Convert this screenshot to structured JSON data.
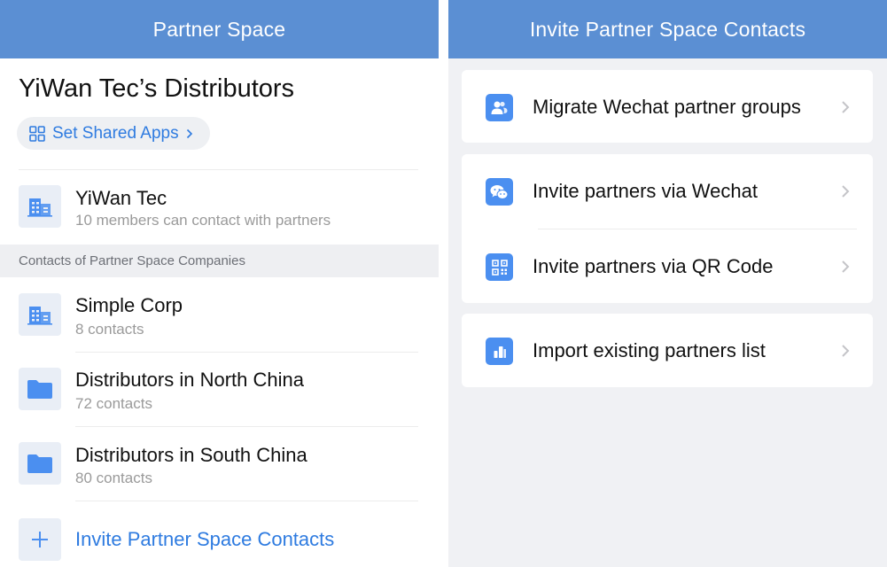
{
  "left_panel": {
    "nav_title": "Partner Space",
    "org_title": "YiWan Tec’s Distributors",
    "shared_apps_label": "Set Shared Apps",
    "own_company": {
      "name": "YiWan Tec",
      "subtitle": "10 members can contact with partners"
    },
    "section_header": "Contacts of Partner Space Companies",
    "companies": [
      {
        "name": "Simple Corp",
        "subtitle": "8 contacts",
        "icon": "building-icon"
      },
      {
        "name": "Distributors in North China",
        "subtitle": "72 contacts",
        "icon": "folder-icon"
      },
      {
        "name": "Distributors in South China",
        "subtitle": "80 contacts",
        "icon": "folder-icon"
      }
    ],
    "invite_label": "Invite Partner Space Contacts"
  },
  "right_panel": {
    "nav_title": "Invite Partner Space Contacts",
    "options": [
      {
        "label": "Migrate Wechat partner groups",
        "icon": "people-icon"
      },
      {
        "label": "Invite partners via Wechat",
        "icon": "wechat-icon"
      },
      {
        "label": "Invite partners via QR Code",
        "icon": "qr-code-icon"
      },
      {
        "label": "Import existing partners list",
        "icon": "import-list-icon"
      }
    ]
  },
  "colors": {
    "nav_bar": "#5b8fd3",
    "accent_blue": "#2e7be0",
    "icon_blue": "#4b8ff0",
    "tile_bg": "#e9eef6",
    "section_bg": "#eeeff2",
    "right_bg": "#f0f1f4"
  }
}
